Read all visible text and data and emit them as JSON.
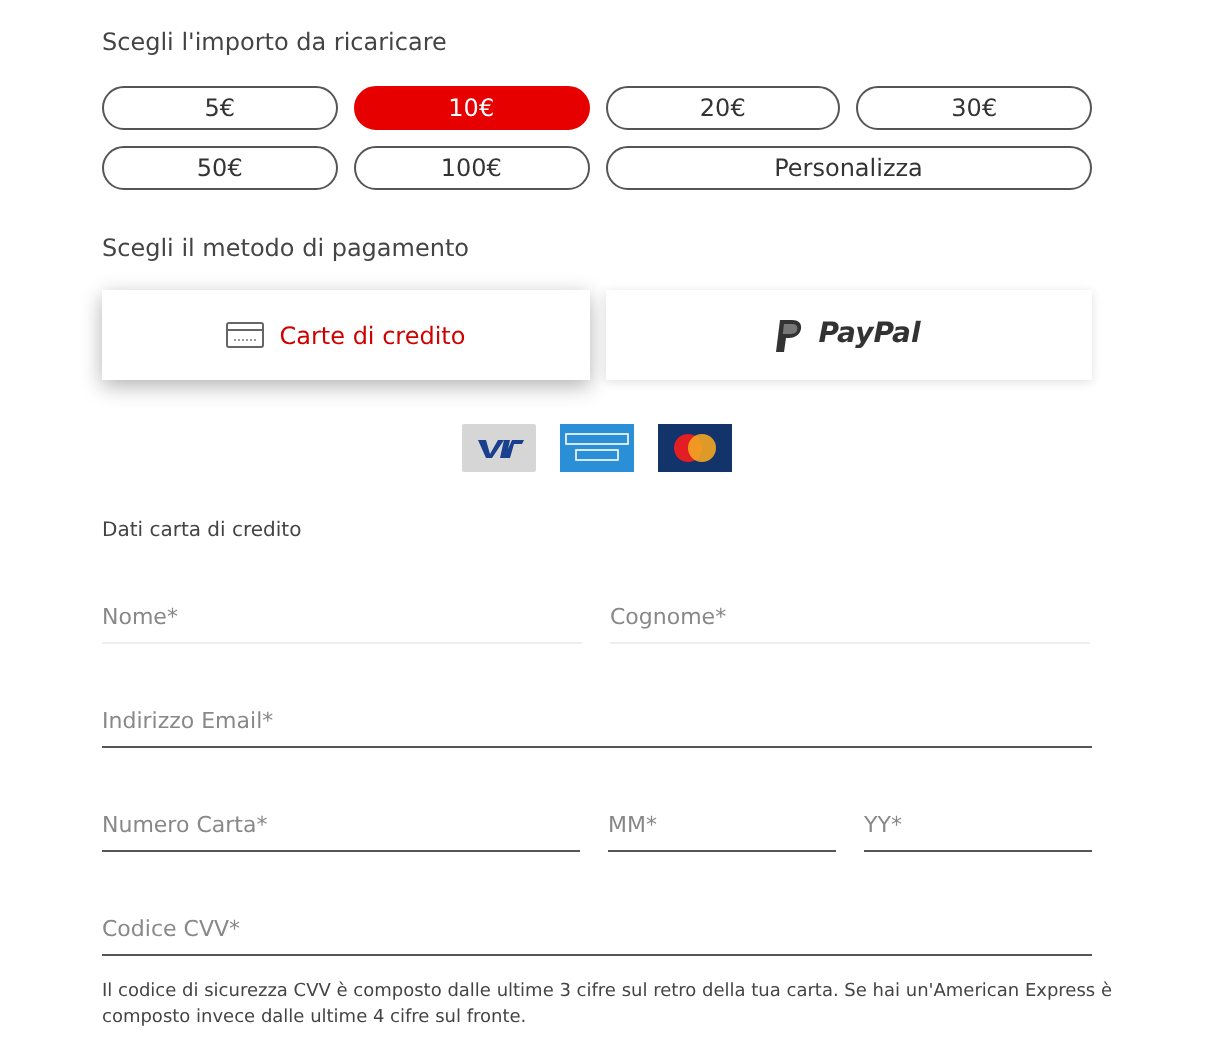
{
  "amount": {
    "title": "Scegli l'importo da ricaricare",
    "options": [
      {
        "label": "5€",
        "selected": false,
        "kind": "fixed"
      },
      {
        "label": "10€",
        "selected": true,
        "kind": "fixed"
      },
      {
        "label": "20€",
        "selected": false,
        "kind": "fixed"
      },
      {
        "label": "30€",
        "selected": false,
        "kind": "fixed"
      },
      {
        "label": "50€",
        "selected": false,
        "kind": "fixed"
      },
      {
        "label": "100€",
        "selected": false,
        "kind": "fixed"
      },
      {
        "label": "Personalizza",
        "selected": false,
        "kind": "custom"
      }
    ]
  },
  "payment": {
    "title": "Scegli il metodo di pagamento",
    "methods": [
      {
        "label": "Carte di credito",
        "selected": true,
        "kind": "card"
      },
      {
        "label": "PayPal",
        "selected": false,
        "kind": "paypal"
      }
    ]
  },
  "card_form": {
    "title": "Dati carta di credito",
    "rows": [
      [
        {
          "placeholder": "Nome*",
          "kind": "faint"
        },
        {
          "placeholder": "Cognome*",
          "kind": "faint"
        }
      ],
      [
        {
          "placeholder": "Indirizzo Email*",
          "kind": "lined"
        }
      ],
      [
        {
          "placeholder": "Numero Carta*",
          "kind": "lined"
        },
        {
          "placeholder": "MM*",
          "kind": "lined"
        },
        {
          "placeholder": "YY*",
          "kind": "lined"
        }
      ],
      [
        {
          "placeholder": "Codice CVV*",
          "kind": "lined"
        }
      ]
    ],
    "note": "Il codice di sicurezza CVV è composto dalle ultime 3 cifre sul retro della tua carta. Se hai un'American Express è composto invece dalle ultime 4 cifre sul fronte."
  }
}
